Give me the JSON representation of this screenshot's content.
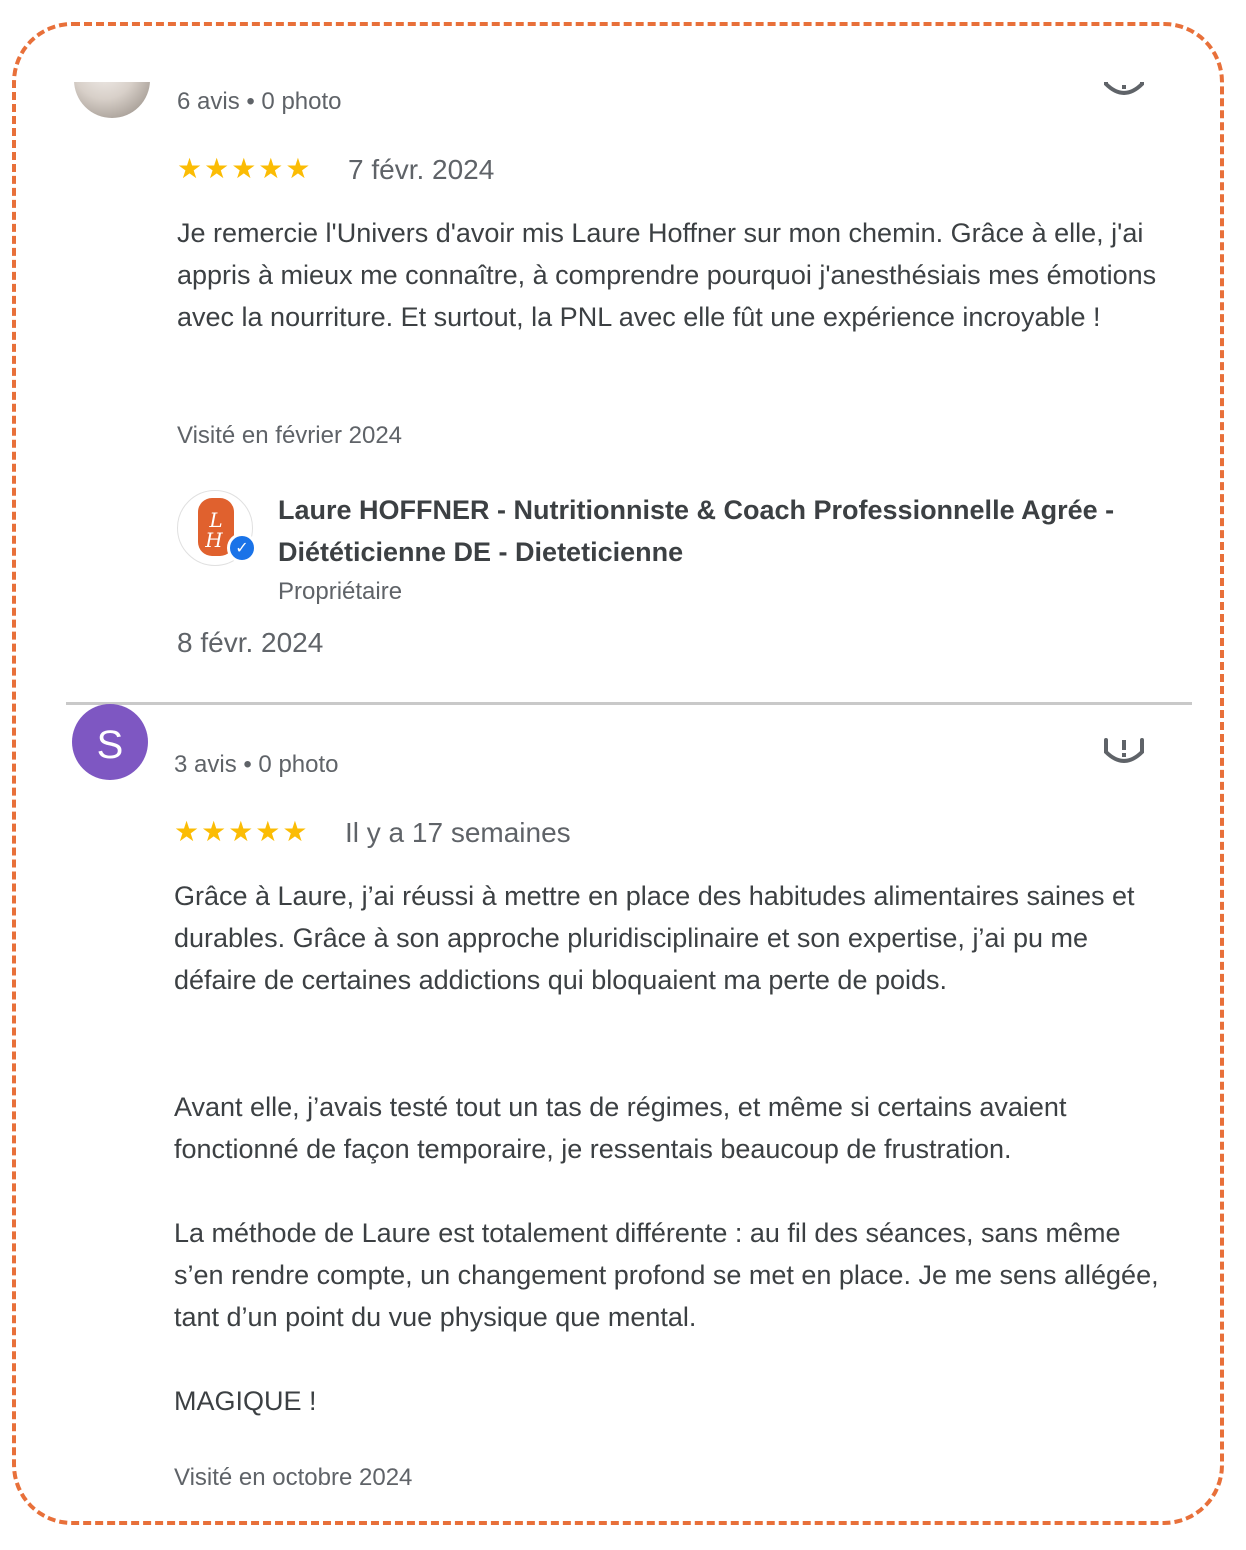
{
  "reviews": [
    {
      "stats": "6 avis • 0 photo",
      "stars": "★★★★★",
      "date": "7 févr. 2024",
      "text": "Je remercie l'Univers d'avoir mis Laure Hoffner sur mon chemin. Grâce à elle, j'ai appris à mieux me connaître, à comprendre pourquoi j'anesthésiais mes émotions avec la nourriture. Et surtout, la PNL avec elle fût une expérience incroyable !",
      "visited": "Visité en février 2024",
      "reply": {
        "owner_name": "Laure HOFFNER - Nutritionniste & Coach Professionnelle Agrée - Diététicienne DE - Dieteticienne",
        "owner_role": "Propriétaire",
        "date": "8 févr. 2024"
      }
    },
    {
      "avatar_letter": "S",
      "stats": "3 avis • 0 photo",
      "stars": "★★★★★",
      "date": "Il y a 17 semaines",
      "paragraphs": [
        "Grâce à Laure, j’ai réussi à mettre en place des habitudes alimentaires saines et durables. Grâce à son approche pluridisciplinaire et son expertise, j’ai pu me défaire de certaines addictions qui bloquaient ma perte de poids.",
        "Avant elle, j’avais testé tout un tas de régimes, et même si certains avaient fonctionné de façon temporaire, je ressentais beaucoup de frustration.",
        "La méthode de Laure est totalement différente : au fil des séances, sans même s’en rendre compte, un changement profond se met en place. Je me sens allégée, tant d’un point du vue physique que mental.",
        "MAGIQUE !"
      ],
      "visited": "Visité en octobre 2024"
    }
  ],
  "colors": {
    "star": "#fbbc04",
    "frame_border": "#e8703a",
    "avatar_s": "#7e57c2",
    "verified": "#1a73e8",
    "logo_orange": "#e0612e"
  },
  "icons": {
    "report": "report-flag-icon",
    "verified": "verified-check-icon"
  }
}
